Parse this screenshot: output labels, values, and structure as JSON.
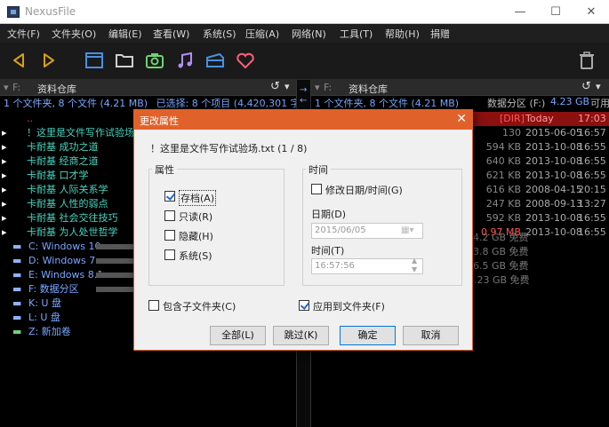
{
  "window": {
    "title": "NexusFile",
    "min": "—",
    "max": "☐",
    "close": "✕"
  },
  "menu": [
    "文件(F)",
    "文件夹(O)",
    "编辑(E)",
    "查看(W)",
    "系统(S)",
    "压缩(A)",
    "网络(N)",
    "工具(T)",
    "帮助(H)",
    "捐赠"
  ],
  "toolbar": {
    "icons": [
      "back-arrow-icon",
      "forward-arrow-icon",
      "window-icon",
      "folder-icon",
      "camera-icon",
      "music-icon",
      "package-icon",
      "heart-icon",
      "trash-icon"
    ],
    "colors": {
      "arrow": "#d4a017",
      "blue": "#4a90e2",
      "camera": "#6fd36f",
      "music": "#b58cff",
      "heart": "#ff5e7a",
      "grey": "#aaaaaa"
    }
  },
  "left_pane": {
    "drive": "F:",
    "path": "资料仓库",
    "info": "1 个文件夹, 8 个文件 (4.21 MB)",
    "info_selected": "已选择: 8 个项目 (4,420,301 字节)",
    "up": "..",
    "files": [
      "！这里是文件写作试验场.txt",
      "卡耐基 成功之道",
      "卡耐基 经商之道",
      "卡耐基 口才学",
      "卡耐基 人际关系学",
      "卡耐基 人性的弱点",
      "卡耐基 社会交往技巧",
      "卡耐基 为人处世哲学"
    ],
    "drives": [
      {
        "label": "C: Windows 10"
      },
      {
        "label": "D: Windows 7"
      },
      {
        "label": "E: Windows 8.1"
      },
      {
        "label": "F: 数据分区"
      },
      {
        "label": "K: U 盘"
      },
      {
        "label": "L: U 盘"
      },
      {
        "label": "Z: 新加卷"
      }
    ]
  },
  "right_pane": {
    "drive": "F:",
    "path": "资料仓库",
    "info": "1 个文件夹, 8 个文件 (4.21 MB)",
    "info_free_label": "数据分区 (F:)",
    "info_free": "4.23 GB",
    "info_free_suffix": "可用",
    "rows": [
      {
        "size": "[DIR]",
        "date": "Today",
        "time": "17:03"
      },
      {
        "size": "130",
        "date": "2015-06-05",
        "time": "16:57"
      },
      {
        "size": "594 KB",
        "date": "2013-10-08",
        "time": "16:55"
      },
      {
        "size": "640 KB",
        "date": "2013-10-08",
        "time": "16:55"
      },
      {
        "size": "621 KB",
        "date": "2013-10-08",
        "time": "16:55"
      },
      {
        "size": "616 KB",
        "date": "2008-04-15",
        "time": "20:15"
      },
      {
        "size": "247 KB",
        "date": "2008-09-13",
        "time": "13:27"
      },
      {
        "size": "592 KB",
        "date": "2013-10-08",
        "time": "16:55"
      },
      {
        "size": "0.97 MB",
        "date": "2013-10-08",
        "time": "16:55"
      }
    ],
    "drive_free": [
      "4.2 GB 免费",
      "3.8 GB 免费",
      "6.5 GB 免费",
      "4.23 GB 免费"
    ]
  },
  "dialog": {
    "title": "更改属性",
    "filename": "！这里是文件写作试验场.txt (1 / 8)",
    "attrs_group": "属性",
    "attrs": [
      {
        "label": "存档(A)",
        "checked": true
      },
      {
        "label": "只读(R)",
        "checked": false
      },
      {
        "label": "隐藏(H)",
        "checked": false
      },
      {
        "label": "系统(S)",
        "checked": false
      }
    ],
    "time_group": "时间",
    "modify_time": "修改日期/时间(G)",
    "date_label": "日期(D)",
    "date_value": "2015/06/05",
    "time_label": "时间(T)",
    "time_value": "16:57:56",
    "include_sub": "包含子文件夹(C)",
    "apply_folders": "应用到文件夹(F)",
    "btn_all": "全部(L)",
    "btn_skip": "跳过(K)",
    "btn_ok": "确定",
    "btn_cancel": "取消"
  }
}
